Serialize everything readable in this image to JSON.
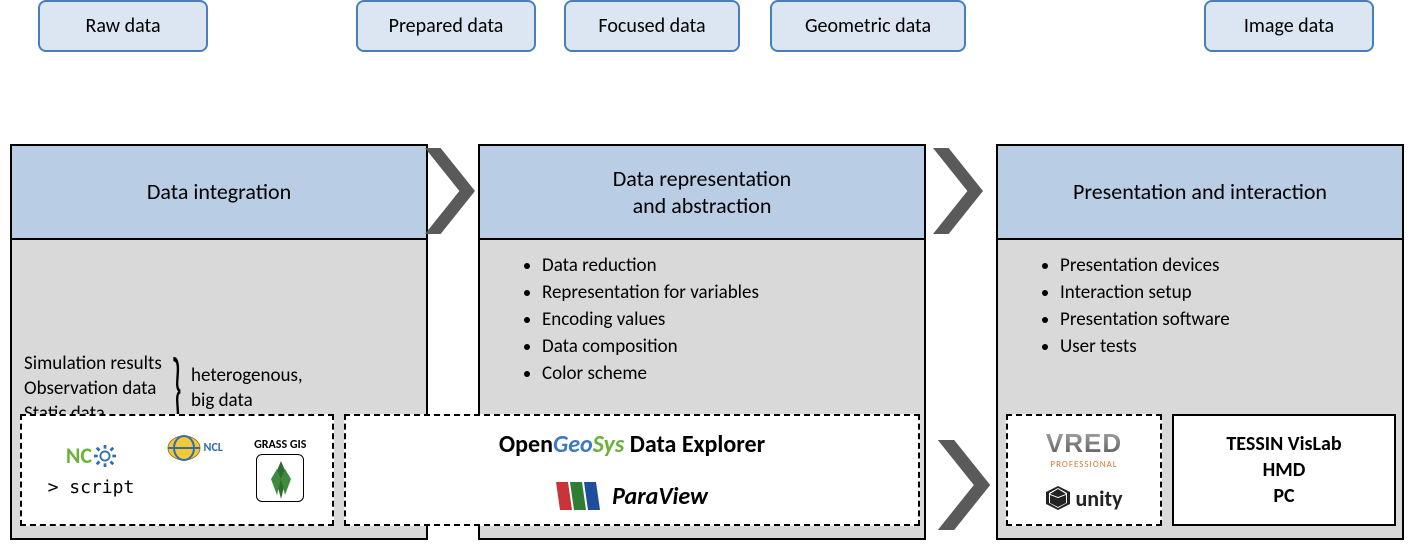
{
  "pills": {
    "raw": "Raw data",
    "prepared": "Prepared data",
    "focused": "Focused data",
    "geometric": "Geometric data",
    "image": "Image data"
  },
  "stages": {
    "s1": {
      "title": "Data integration",
      "left": [
        "Simulation results",
        "Observation data",
        "Static data"
      ],
      "right": [
        "heterogenous,",
        "big data"
      ]
    },
    "s2": {
      "title": "Data representation\nand abstraction",
      "bullets": [
        "Data reduction",
        "Representation for variables",
        "Encoding values",
        "Data composition",
        "Color scheme"
      ]
    },
    "s3": {
      "title": "Presentation and interaction",
      "bullets": [
        "Presentation devices",
        "Interaction setup",
        "Presentation software",
        "User tests"
      ]
    }
  },
  "software": {
    "box1": {
      "nco": "NC",
      "ncl": "NCL",
      "grass": "GRASS GIS",
      "script": "> script"
    },
    "box2": {
      "ogs_open": "Open",
      "ogs_geo": "Geo",
      "ogs_sys": "Sys",
      "ogs_rest": " Data Explorer",
      "paraview": "ParaView"
    },
    "box3": {
      "vred": "VRED",
      "vred_sub": "PROFESSIONAL",
      "unity": "unity"
    },
    "box4": {
      "line1": "TESSIN VisLab",
      "line2": "HMD",
      "line3": "PC"
    }
  }
}
